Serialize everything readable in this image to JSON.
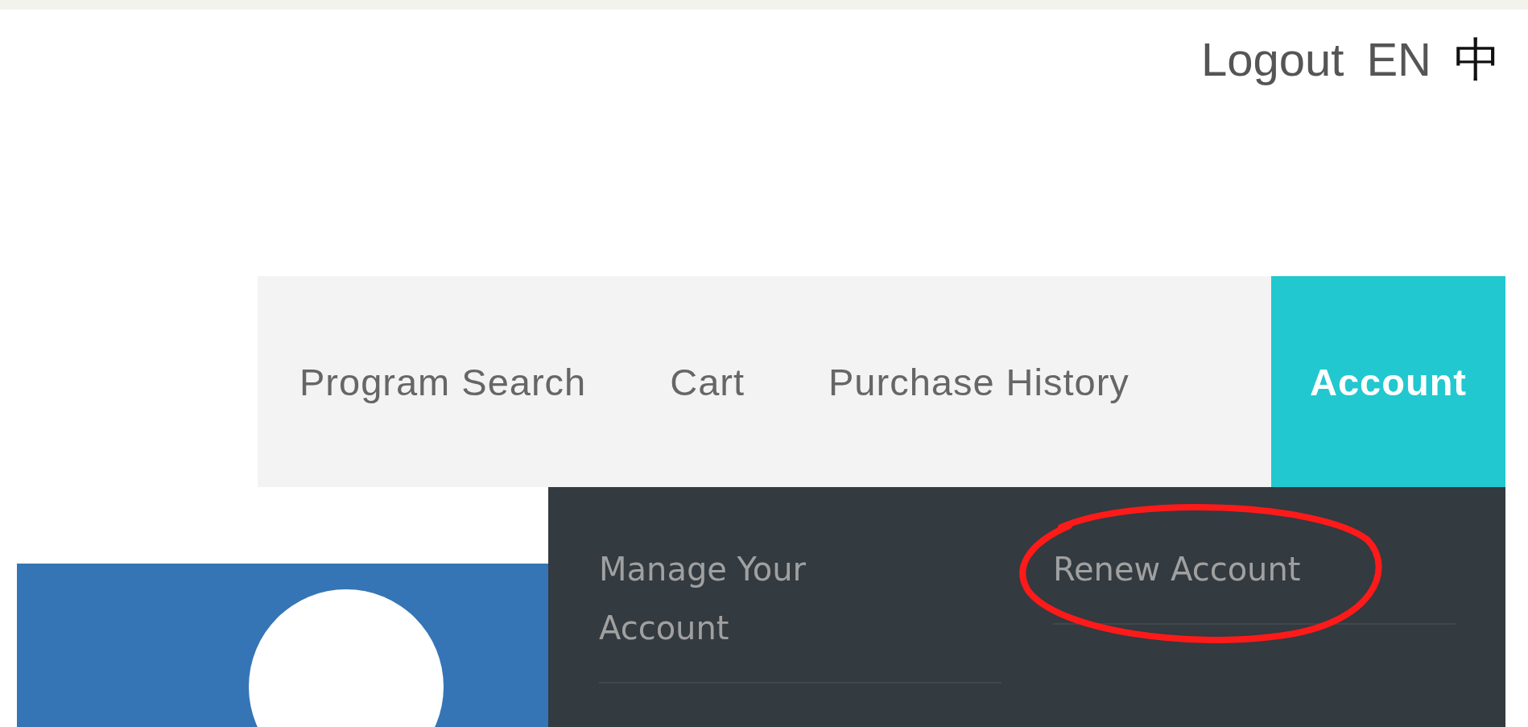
{
  "top_links": [
    {
      "label": "Logout"
    },
    {
      "label": "EN"
    },
    {
      "label": "中"
    }
  ],
  "nav": [
    {
      "label": "Program Search",
      "selected": false
    },
    {
      "label": "Cart",
      "selected": false
    },
    {
      "label": "Purchase History",
      "selected": false
    },
    {
      "label": "Account",
      "selected": true
    }
  ],
  "account_menu": [
    {
      "label": "Manage Your Account",
      "circled": false
    },
    {
      "label": "Renew Account",
      "circled": true
    }
  ]
}
